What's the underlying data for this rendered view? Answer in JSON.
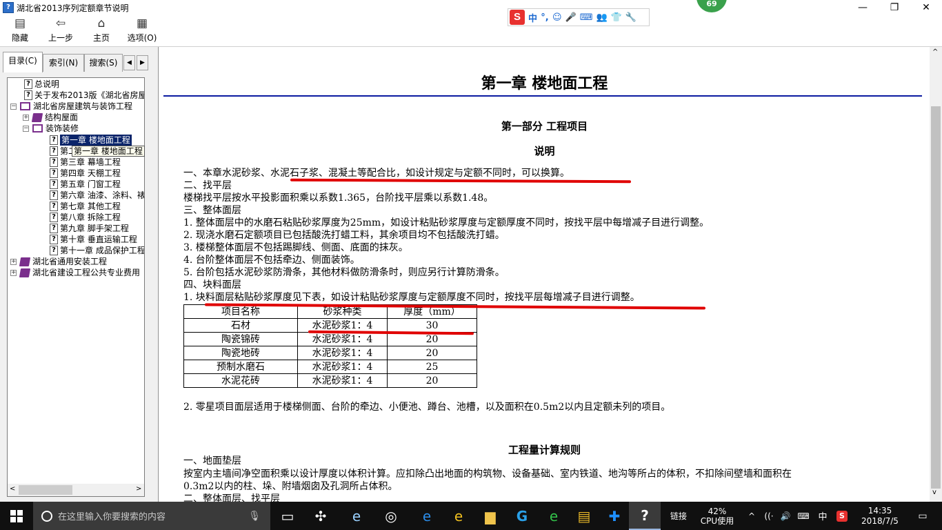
{
  "window": {
    "title": "湖北省2013序列定额章节说明",
    "app_icon": "?",
    "minimize_icon": "—",
    "restore_icon": "❐",
    "close_icon": "✕"
  },
  "ime": {
    "logo": "S",
    "items": [
      "中",
      "°,",
      "☺",
      "🎤",
      "⌨",
      "👥",
      "👕",
      "🔧"
    ]
  },
  "badge": {
    "value": "69"
  },
  "toolbar": {
    "hide_label": "隐藏",
    "back_label": "上一步",
    "home_label": "主页",
    "options_label": "选项(O)",
    "icons": {
      "hide": "▤",
      "back": "⇦",
      "home": "⌂",
      "options": "▦"
    }
  },
  "tabs": {
    "contents": "目录(C)",
    "index": "索引(N)",
    "search": "搜索(S)",
    "prev": "◀",
    "next": "▶"
  },
  "tree": {
    "items": [
      {
        "label": "总说明"
      },
      {
        "label": "关于发布2013版《湖北省房屋"
      },
      {
        "label": "湖北省房屋建筑与装饰工程"
      },
      {
        "label": "结构屋面"
      },
      {
        "label": "装饰装修"
      },
      {
        "label": "第一章  楼地面工程"
      },
      {
        "label": "第二章  墙柱面工程"
      },
      {
        "label": "第三章  幕墙工程"
      },
      {
        "label": "第四章  天棚工程"
      },
      {
        "label": "第五章  门窗工程"
      },
      {
        "label": "第六章  油漆、涂料、裱糊工程"
      },
      {
        "label": "第七章  其他工程"
      },
      {
        "label": "第八章  拆除工程"
      },
      {
        "label": "第九章  脚手架工程"
      },
      {
        "label": "第十章  垂直运输工程"
      },
      {
        "label": "第十一章  成品保护工程"
      },
      {
        "label": "湖北省通用安装工程"
      },
      {
        "label": "湖北省建设工程公共专业费用"
      }
    ],
    "tooltip": "第一章  楼地面工程"
  },
  "content": {
    "chapter_title": "第一章  楼地面工程",
    "part_title": "第一部分  工程项目",
    "explain_title": "说明",
    "lines": [
      "一、本章水泥砂浆、水泥石子浆、混凝土等配合比，如设计规定与定额不同时，可以换算。",
      "二、找平层",
      "楼梯找平层按水平投影面积乘以系数1.365，台阶找平层乘以系数1.48。",
      "三、整体面层",
      "1. 整体面层中的水磨石粘贴砂浆厚度为25mm，如设计粘贴砂浆厚度与定额厚度不同时，按找平层中每增减子目进行调整。",
      "2. 现浇水磨石定额项目已包括酸洗打蜡工料，其余项目均不包括酸洗打蜡。",
      "3. 楼梯整体面层不包括踢脚线、侧面、底面的抹灰。",
      "4. 台阶整体面层不包括牵边、侧面装饰。",
      "5. 台阶包括水泥砂浆防滑条，其他材料做防滑条时，则应另行计算防滑条。",
      "四、块料面层",
      "1. 块料面层粘贴砂浆厚度见下表，如设计粘贴砂浆厚度与定额厚度不同时，按找平层每增减子目进行调整。"
    ],
    "table": {
      "headers": [
        "项目名称",
        "砂浆种类",
        "厚度（mm）"
      ],
      "rows": [
        [
          "石材",
          "水泥砂浆1：4",
          "30"
        ],
        [
          "陶瓷锦砖",
          "水泥砂浆1：4",
          "20"
        ],
        [
          "陶瓷地砖",
          "水泥砂浆1：4",
          "20"
        ],
        [
          "预制水磨石",
          "水泥砂浆1：4",
          "25"
        ],
        [
          "水泥花砖",
          "水泥砂浆1：4",
          "20"
        ]
      ]
    },
    "note2": "2. 零星项目面层适用于楼梯侧面、台阶的牵边、小便池、蹲台、池槽，以及面积在0.5m2以内且定额未列的项目。",
    "rules_title": "工程量计算规则",
    "rules_lines": [
      "一、地面垫层",
      "按室内主墙间净空面积乘以设计厚度以体积计算。应扣除凸出地面的构筑物、设备基础、室内铁道、地沟等所占的体积，不扣除间壁墙和面积在",
      "0.3m2以内的柱、垛、附墙烟囱及孔洞所占体积。",
      "二、整体面层、找平层"
    ],
    "annotation_color": "#e00000"
  },
  "taskbar": {
    "search_placeholder": "在这里输入你要搜索的内容",
    "apps": [
      "▭",
      "✣",
      "e",
      "◎",
      "e",
      "e",
      "▆",
      "G",
      "e",
      "▤",
      "✚",
      "?"
    ],
    "links_label": "链接",
    "cpu_percent": "42%",
    "cpu_label": "CPU使用",
    "tray_icons": [
      "^",
      "((·",
      "🔊",
      "⌨"
    ],
    "ime_lang": "中",
    "time": "14:35",
    "date": "2018/7/5",
    "notification_icon": "▭"
  }
}
